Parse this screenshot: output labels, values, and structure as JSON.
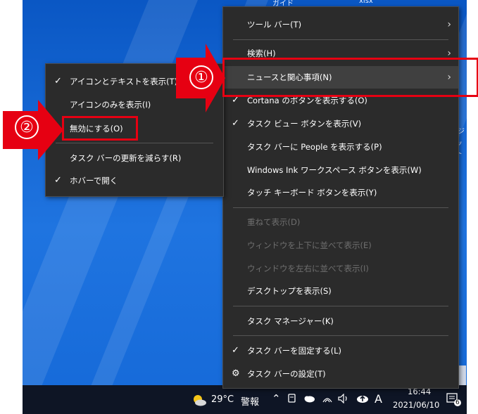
{
  "desktop": {
    "top_label_left": "ガイド",
    "top_label_right": "xlsx",
    "right_edge_label_1": "ジ",
    "right_edge_label_2": "ット"
  },
  "context_menu": {
    "items": [
      {
        "label": "ツール バー(T)",
        "submenu": true
      },
      {
        "label": "検索(H)",
        "submenu": true
      },
      {
        "label": "ニュースと関心事項(N)",
        "submenu": true,
        "highlighted": true
      },
      {
        "label": "Cortana のボタンを表示する(O)",
        "checked": true
      },
      {
        "label": "タスク ビュー ボタンを表示(V)",
        "checked": true
      },
      {
        "label": "タスク バーに People を表示する(P)"
      },
      {
        "label": "Windows Ink ワークスペース ボタンを表示(W)"
      },
      {
        "label": "タッチ キーボード ボタンを表示(Y)"
      },
      {
        "label": "重ねて表示(D)",
        "disabled": true
      },
      {
        "label": "ウィンドウを上下に並べて表示(E)",
        "disabled": true
      },
      {
        "label": "ウィンドウを左右に並べて表示(I)",
        "disabled": true
      },
      {
        "label": "デスクトップを表示(S)"
      },
      {
        "label": "タスク マネージャー(K)"
      },
      {
        "label": "タスク バーを固定する(L)",
        "checked": true
      },
      {
        "label": "タスク バーの設定(T)",
        "icon": "gear-icon"
      }
    ]
  },
  "submenu": {
    "items": [
      {
        "label": "アイコンとテキストを表示(T)",
        "checked": true
      },
      {
        "label": "アイコンのみを表示(I)"
      },
      {
        "label": "無効にする(O)"
      },
      {
        "label": "タスク バーの更新を減らす(R)"
      },
      {
        "label": "ホバーで開く",
        "checked": true
      }
    ]
  },
  "annotations": {
    "step1": "①",
    "step2": "②",
    "highlight_color": "#e60012"
  },
  "taskbar": {
    "weather_icon": "sun-cloud-icon",
    "temperature": "29°C",
    "warning": "警報",
    "ime": "A",
    "time": "16:44",
    "date": "2021/06/10",
    "notification_count": "6"
  },
  "check_glyph": "✓",
  "arrow_glyph": "›"
}
